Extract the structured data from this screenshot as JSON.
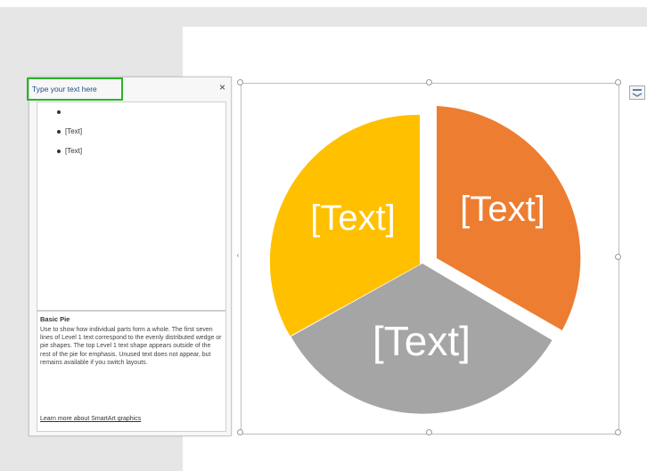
{
  "text_pane": {
    "title": "Type your text here",
    "close_label": "×",
    "bullets": [
      "",
      "[Text]",
      "[Text]"
    ],
    "description_title": "Basic Pie",
    "description_body": "Use to show how individual parts form a whole. The first seven lines of Level 1 text correspond to the evenly distributed wedge or pie shapes. The top Level 1 text shape appears outside of the rest of the pie for emphasis. Unused text does not appear, but remains available if you switch layouts.",
    "learn_more_link": "Learn more about SmartArt graphics"
  },
  "pie": {
    "slices": [
      {
        "label": "[Text]",
        "color": "#ed7d31",
        "shape": "orange-slice"
      },
      {
        "label": "[Text]",
        "color": "#a5a5a5",
        "shape": "gray-slice"
      },
      {
        "label": "[Text]",
        "color": "#ffc000",
        "shape": "yellow-slice"
      }
    ]
  },
  "colors": {
    "pane_title_border": "#28b528",
    "pane_title_text": "#1a4d8c",
    "page_background": "#e6e6e6"
  },
  "icons": {
    "close": "close-icon",
    "layout_options": "layout-options-icon",
    "pane_toggle": "chevron-left-icon"
  }
}
